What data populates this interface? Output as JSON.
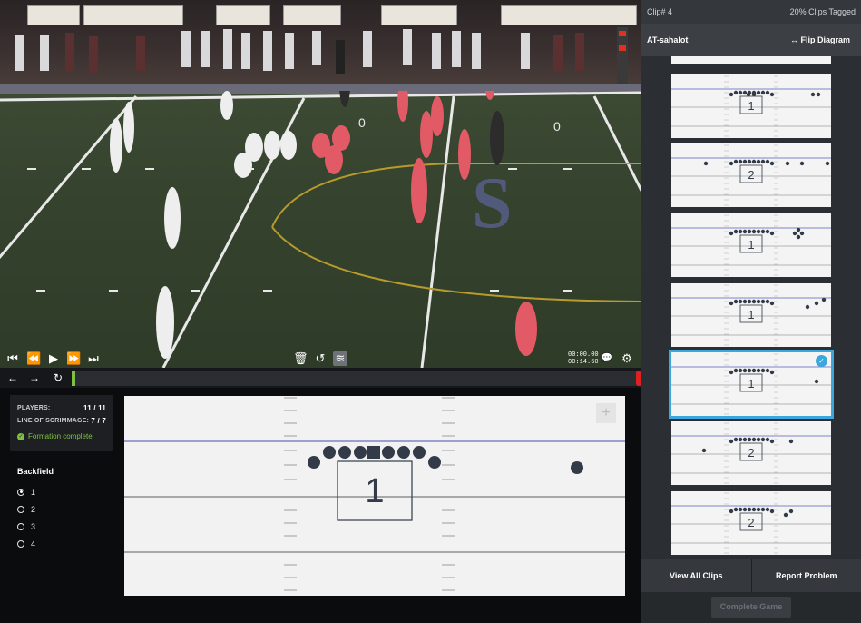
{
  "video": {
    "time_current": "00:00.00",
    "time_total": "00:14.50",
    "controls": {
      "skip_back": "⏮",
      "rewind": "⏪",
      "play": "▶",
      "forward": "⏩",
      "skip_forward": "⏭",
      "delete": "🗑",
      "undo": "↺",
      "toggle": "≋",
      "comment": "💬",
      "settings": "⚙"
    }
  },
  "scrubber": {
    "prev": "←",
    "next": "→",
    "refresh": "↻"
  },
  "status": {
    "players_label": "PLAYERS:",
    "players_value": "11 / 11",
    "los_label": "LINE OF SCRIMMAGE:",
    "los_value": "7 / 7",
    "complete_text": "Formation complete"
  },
  "backfield": {
    "title": "Backfield",
    "options": [
      "1",
      "2",
      "3",
      "4"
    ],
    "selected": "1"
  },
  "diagram": {
    "formation_number": "1",
    "add": "+"
  },
  "sidebar": {
    "clip_label": "Clip# 4",
    "tagged_label": "20% Clips Tagged",
    "team": "AT-sahalot",
    "flip": "Flip Diagram",
    "flip_icon": "↔",
    "thumbnails": [
      "1",
      "2",
      "1",
      "1",
      "1",
      "2",
      "2"
    ],
    "selected_index": 4,
    "view_all": "View All Clips",
    "report": "Report Problem",
    "complete": "Complete Game"
  },
  "colors": {
    "accent": "#3aa8dc",
    "success": "#7ec242",
    "alert": "#e02020",
    "los_line": "#7d84c8"
  }
}
